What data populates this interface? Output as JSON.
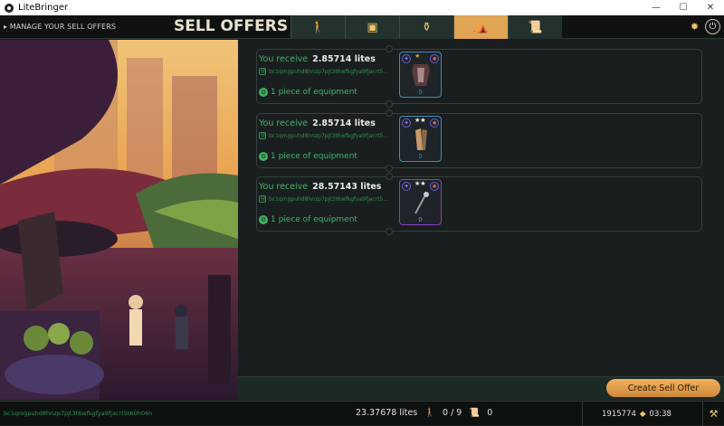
{
  "window": {
    "title": "LiteBringer",
    "minimize": "—",
    "maximize": "☐",
    "close": "✕"
  },
  "header": {
    "manage_label": "▸ MANAGE YOUR SELL OFFERS",
    "title": "SELL OFFERS",
    "tabs": [
      {
        "icon": "character-icon",
        "glyph": "🚶",
        "active": false
      },
      {
        "icon": "chest-icon",
        "glyph": "▣",
        "active": false
      },
      {
        "icon": "treasure-icon",
        "glyph": "⚱",
        "active": false
      },
      {
        "icon": "market-icon",
        "glyph": "⛺",
        "active": true
      },
      {
        "icon": "scroll-icon",
        "glyph": "📜",
        "active": false
      }
    ],
    "settings_icon": "gear-icon",
    "power_icon": "power-icon"
  },
  "offers": [
    {
      "receive_label": "You receive",
      "amount": "2.85714 lites",
      "address": "bc1qmgpuhd8hnzp7pjt3t6wfkgfya9fjacrt5...",
      "pieces": "1 piece of equipment",
      "stars": "★",
      "star_color": "orange",
      "count": "0",
      "rarity": "rare",
      "item": "armor"
    },
    {
      "receive_label": "You receive",
      "amount": "2.85714 lites",
      "address": "bc1qmgpuhd8hnzp7pjt3t6wfkgfya9fjacrt5...",
      "pieces": "1 piece of equipment",
      "stars": "★★",
      "star_color": "white",
      "count": "0",
      "rarity": "rare",
      "item": "gloves"
    },
    {
      "receive_label": "You receive",
      "amount": "28.57143 lites",
      "address": "bc1qmgpuhd8hnzp7pjt3t6wfkgfya9fjacrt5...",
      "pieces": "1 piece of equipment",
      "stars": "★★",
      "star_color": "white",
      "count": "0",
      "rarity": "epic",
      "item": "staff"
    }
  ],
  "create_button": "Create Sell Offer",
  "status": {
    "address": "bc1qmgpuhd8hnzp7pjt3t6wfkgfya9fjacrt5t60h06n",
    "balance": "23.37678 lites",
    "characters": "0 / 9",
    "scrolls": "0",
    "block": "1915774",
    "time": "03:38"
  },
  "colors": {
    "accent": "#e0a455",
    "green": "#3fb56b",
    "rare": "#3c8fb6",
    "epic": "#8b3fc0"
  }
}
